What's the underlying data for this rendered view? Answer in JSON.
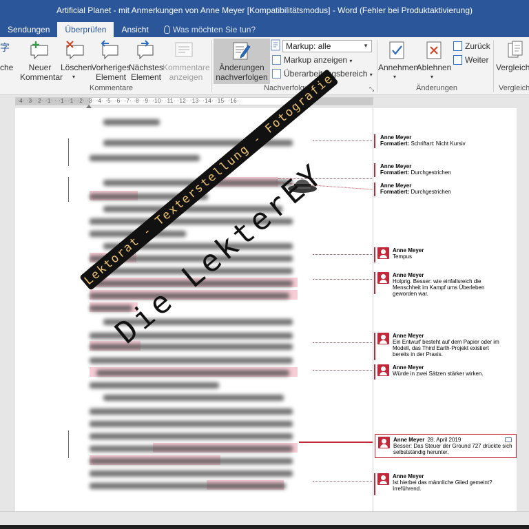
{
  "window": {
    "title": "Artificial Planet - mit Anmerkungen von Anne Meyer [Kompatibilitätsmodus] - Word (Fehler bei Produktaktivierung)"
  },
  "tabs": [
    {
      "label": "Sendungen"
    },
    {
      "label": "Überprüfen"
    },
    {
      "label": "Ansicht"
    }
  ],
  "tell_me": "Was möchten Sie tun?",
  "ribbon": {
    "cut_left_top": "字",
    "cut_left_label": "che",
    "new_comment": [
      "Neuer",
      "Kommentar"
    ],
    "delete": "Löschen",
    "previous": [
      "Vorheriges",
      "Element"
    ],
    "next": [
      "Nächstes",
      "Element"
    ],
    "show_comments": [
      "Kommentare",
      "anzeigen"
    ],
    "group_comments": "Kommentare",
    "track_changes": [
      "Änderungen",
      "nachverfolgen"
    ],
    "markup_select": "Markup: alle",
    "show_markup": "Markup anzeigen",
    "review_pane": "Überarbeitungsbereich",
    "group_tracking": "Nachverfolgung",
    "accept": "Annehmen",
    "reject": "Ablehnen",
    "back": "Zurück",
    "forward": "Weiter",
    "group_changes": "Änderungen",
    "compare": "Vergleiche",
    "group_compare": "Vergleiche"
  },
  "ruler": {
    "numbers": "·4· ·3· ·2· ·1· · ·1· ·1· ·2· ·3· ·4· ·5· ·6· ·7· ·8· ·9· ·10· ·11· ·12· ·13· ·14· ·15· ·16·"
  },
  "formatting_notes": [
    {
      "author": "Anne Meyer",
      "label": "Formatiert:",
      "text": "Schriftart: Nicht Kursiv"
    },
    {
      "author": "Anne Meyer",
      "label": "Formatiert:",
      "text": "Durchgestrichen"
    },
    {
      "author": "Anne Meyer",
      "label": "Formatiert:",
      "text": "Durchgestrichen"
    }
  ],
  "comments": [
    {
      "author": "Anne Meyer",
      "date": "",
      "text": "Tempus"
    },
    {
      "author": "Anne Meyer",
      "date": "",
      "text": "Holprig. Besser: wie einfallsreich die Menschheit im Kampf ums Überleben geworden war."
    },
    {
      "author": "Anne Meyer",
      "date": "",
      "text": "Ein Entwurf besteht auf dem Papier oder im Modell, das Third Earth-Projekt existiert bereits in der Praxis."
    },
    {
      "author": "Anne Meyer",
      "date": "",
      "text": "Würde in zwei Sätzen stärker wirken."
    },
    {
      "author": "Anne Meyer",
      "date": "28. April 2019",
      "text": "Besser: Das Steuer der Ground 727 drückte sich selbstständig herunter."
    },
    {
      "author": "Anne Meyer",
      "date": "",
      "text": "Ist hierbei das männliche Glied gemeint? Irreführend."
    }
  ],
  "watermark": {
    "title": "Die LekterEY",
    "subtitle": "Lektorat - Texterstellung - Fotografie"
  },
  "colors": {
    "title_bar": "#2b579a",
    "comment_accent": "#c2283a",
    "highlight": "#f5c6d0"
  }
}
